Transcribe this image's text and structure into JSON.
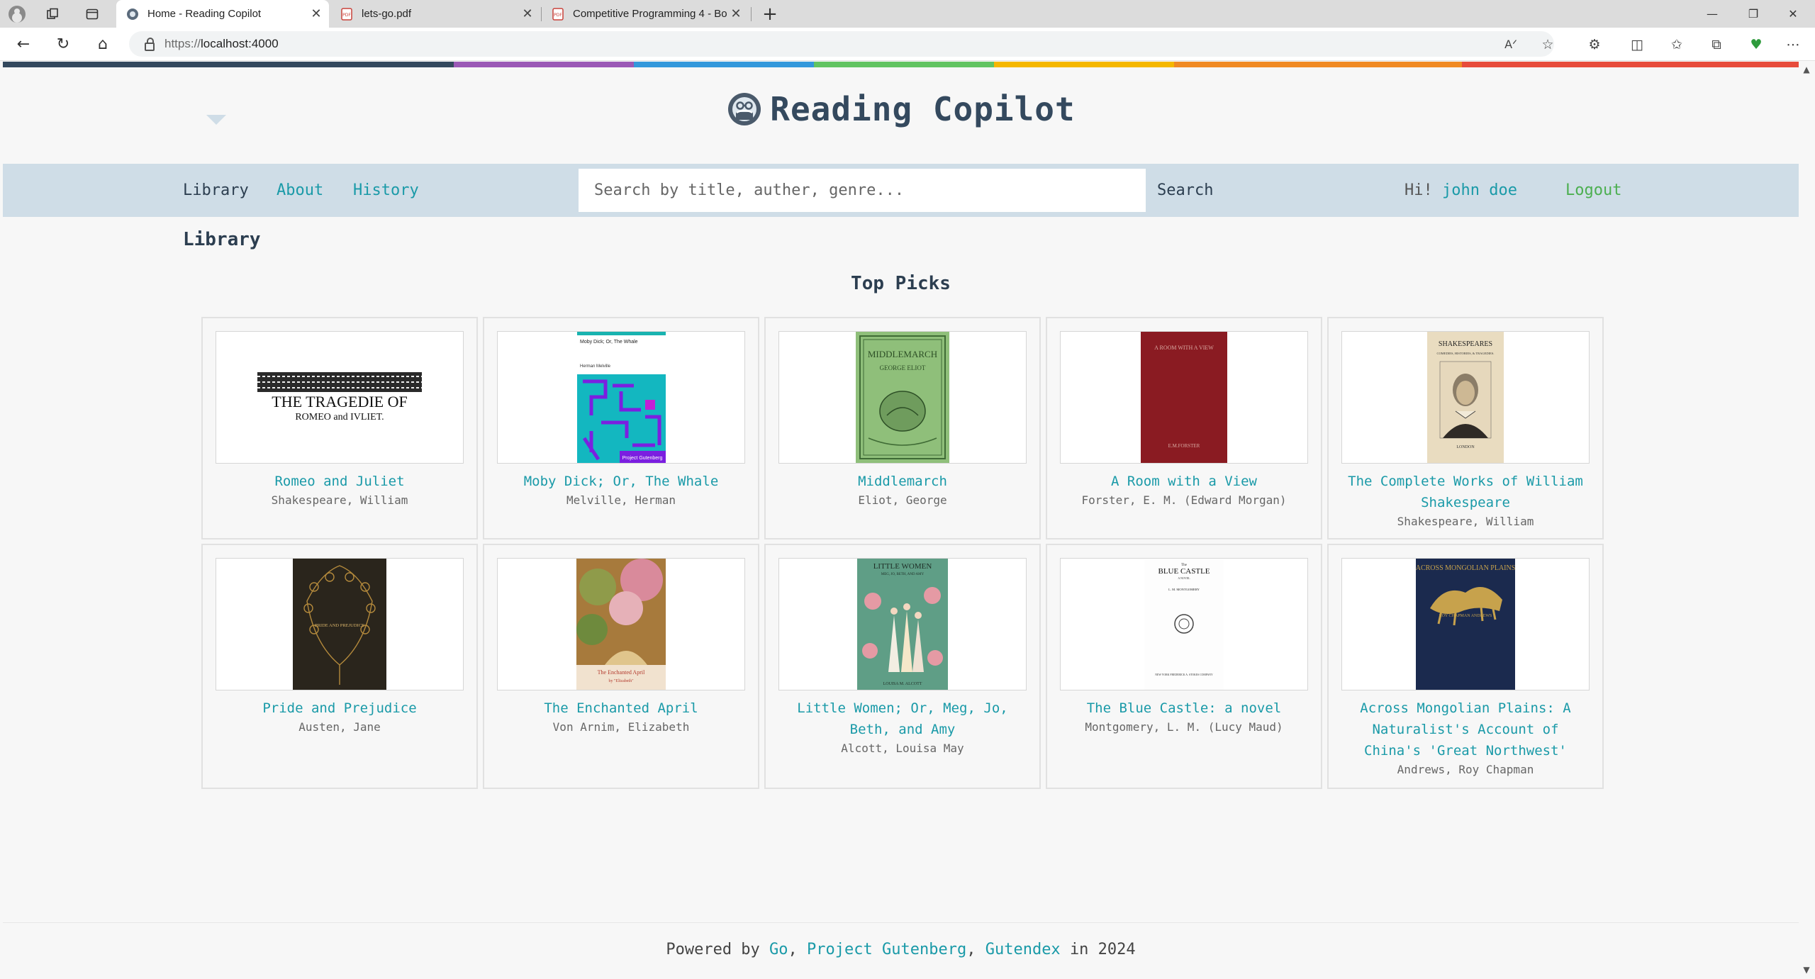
{
  "browser": {
    "tabs": [
      {
        "title": "Home - Reading Copilot",
        "active": true
      },
      {
        "title": "lets-go.pdf",
        "active": false
      },
      {
        "title": "Competitive Programming 4 - Bo",
        "active": false
      }
    ],
    "new_tab_label": "+",
    "url_scheme": "https://",
    "url_host": "localhost:4000",
    "window_controls": [
      "—",
      "❐",
      "✕"
    ]
  },
  "rainbow_colors": [
    "#34495e",
    "#9b59b6",
    "#3498db",
    "#62c462",
    "#f5b700",
    "#f08a24",
    "#e74c3c"
  ],
  "site": {
    "brand": "Reading Copilot",
    "nav": {
      "library": "Library",
      "about": "About",
      "history": "History"
    },
    "search_placeholder": "Search by title, auther, genre...",
    "search_button": "Search",
    "greeting_prefix": "Hi!",
    "user_name": "john doe",
    "logout": "Logout"
  },
  "page": {
    "heading": "Library",
    "section_title": "Top Picks"
  },
  "books": [
    {
      "title": "Romeo and Juliet",
      "author": "Shakespeare, William",
      "cover": "romeo"
    },
    {
      "title": "Moby Dick; Or, The Whale",
      "author": "Melville, Herman",
      "cover": "moby"
    },
    {
      "title": "Middlemarch",
      "author": "Eliot, George",
      "cover": "middlemarch"
    },
    {
      "title": "A Room with a View",
      "author": "Forster, E. M. (Edward Morgan)",
      "cover": "room"
    },
    {
      "title": "The Complete Works of William Shakespeare",
      "author": "Shakespeare, William",
      "cover": "complete"
    },
    {
      "title": "Pride and Prejudice",
      "author": "Austen, Jane",
      "cover": "pride"
    },
    {
      "title": "The Enchanted April",
      "author": "Von Arnim, Elizabeth",
      "cover": "april"
    },
    {
      "title": "Little Women; Or, Meg, Jo, Beth, and Amy",
      "author": "Alcott, Louisa May",
      "cover": "women"
    },
    {
      "title": "The Blue Castle: a novel",
      "author": "Montgomery, L. M. (Lucy Maud)",
      "cover": "castle"
    },
    {
      "title": "Across Mongolian Plains: A Naturalist's Account of China's 'Great Northwest'",
      "author": "Andrews, Roy Chapman",
      "cover": "mongolian"
    }
  ],
  "cover_text": {
    "romeo_line1": "THE TRAGEDIE OF",
    "romeo_line2": "ROMEO and IVLIET.",
    "moby_title": "Moby Dick; Or, The Whale",
    "moby_author": "Herman Melville",
    "moby_footer": "Project Gutenberg",
    "middlemarch_title": "MIDDLEMARCH",
    "middlemarch_author": "GEORGE ELIOT",
    "room_title": "A ROOM WITH A VIEW",
    "room_author": "E.M.FORSTER",
    "complete_line1": "SHAKESPEARES",
    "complete_line2": "COMEDIES, HISTORIES, & TRAGEDIES.",
    "complete_line3": "LONDON",
    "pride_title": "PRIDE AND PREJUDICE",
    "april_title": "The Enchanted April",
    "april_by": "by \"Elizabeth\"",
    "women_title": "LITTLE WOMEN",
    "women_sub": "MEG, JO, BETH, AND AMY",
    "women_author": "LOUISA M. ALCOTT",
    "castle_the": "The",
    "castle_title": "BLUE CASTLE",
    "castle_sub": "A NOVEL",
    "castle_author": "L. M. MONTGOMERY",
    "castle_publisher": "NEW YORK FREDERICK A. STOKES COMPANY",
    "mongolian_title": "ACROSS MONGOLIAN PLAINS",
    "mongolian_author": "ROY CHAPMAN ANDREWS"
  },
  "footer": {
    "prefix": "Powered by",
    "link_go": "Go",
    "sep1": ",",
    "link_gutenberg": "Project Gutenberg",
    "sep2": ",",
    "link_gutendex": "Gutendex",
    "suffix": "in 2024"
  }
}
